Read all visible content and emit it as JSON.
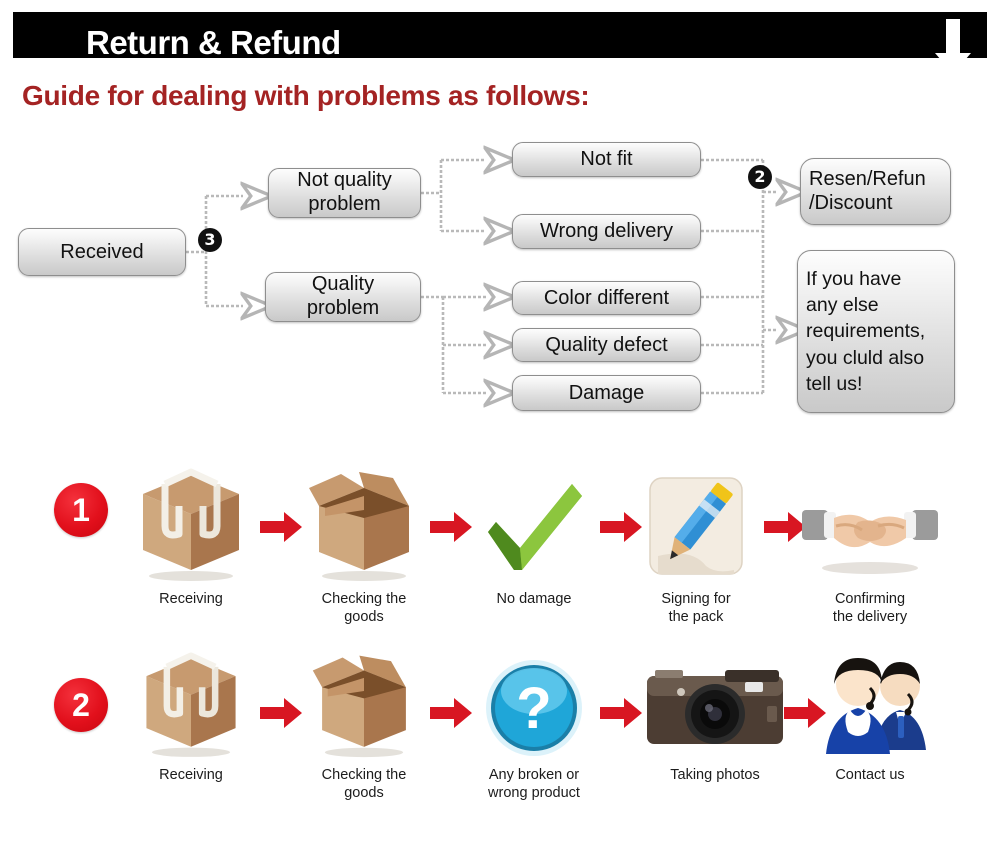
{
  "banner": {
    "title": "Return & Refund",
    "arrow_icon": "down-arrow-icon"
  },
  "guide_heading": "Guide for dealing with problems as follows:",
  "colors": {
    "banner_bg": "#000000",
    "heading_red": "#a42323",
    "arrow_red": "#d81622",
    "number_red": "#e2101c",
    "node_border": "#8e8e8e"
  },
  "flowchart": {
    "badges": [
      {
        "label": "3",
        "name": "badge-three"
      },
      {
        "label": "2",
        "name": "badge-two"
      }
    ],
    "nodes": [
      {
        "id": "received",
        "label": "Received"
      },
      {
        "id": "not-quality",
        "label": "Not quality\nproblem"
      },
      {
        "id": "quality",
        "label": "Quality\nproblem"
      },
      {
        "id": "not-fit",
        "label": "Not fit"
      },
      {
        "id": "wrong-delivery",
        "label": "Wrong delivery"
      },
      {
        "id": "color-different",
        "label": "Color different"
      },
      {
        "id": "quality-defect",
        "label": "Quality defect"
      },
      {
        "id": "damage",
        "label": "Damage"
      },
      {
        "id": "resend",
        "label": "Resen/Refun\n/Discount"
      },
      {
        "id": "contact-note",
        "label": "If you have\nany else\nrequirements,\nyou cluld also\ntell us!"
      }
    ]
  },
  "process_rows": [
    {
      "number": "1",
      "steps": [
        {
          "icon": "closed-box-icon",
          "label": "Receiving"
        },
        {
          "icon": "open-box-icon",
          "label": "Checking the\ngoods"
        },
        {
          "icon": "green-check-icon",
          "label": "No damage"
        },
        {
          "icon": "pencil-sign-icon",
          "label": "Signing for\nthe pack"
        },
        {
          "icon": "handshake-icon",
          "label": "Confirming\nthe delivery"
        }
      ]
    },
    {
      "number": "2",
      "steps": [
        {
          "icon": "closed-box-icon",
          "label": "Receiving"
        },
        {
          "icon": "open-box-icon",
          "label": "Checking the\ngoods"
        },
        {
          "icon": "question-mark-icon",
          "label": "Any broken or\nwrong product"
        },
        {
          "icon": "camera-icon",
          "label": "Taking photos"
        },
        {
          "icon": "support-agents-icon",
          "label": "Contact us"
        }
      ]
    }
  ]
}
